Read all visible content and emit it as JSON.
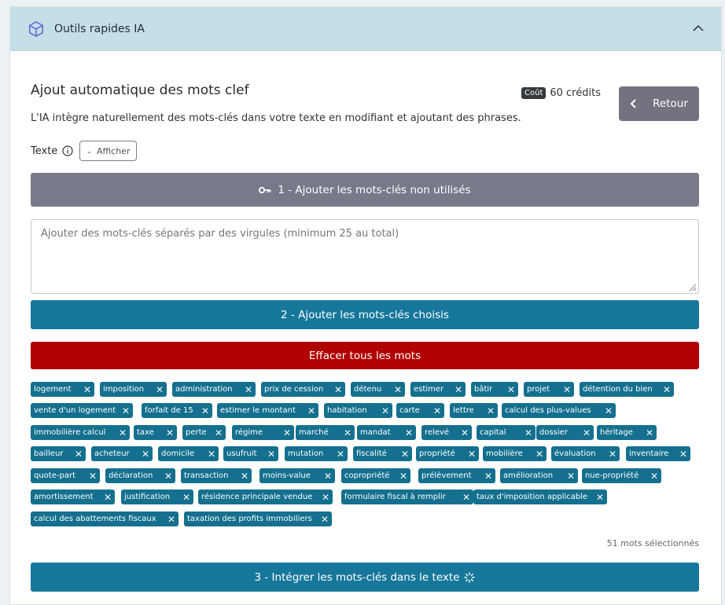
{
  "header": {
    "title": "Outils rapides IA"
  },
  "tool": {
    "title": "Ajout automatique des mots clef",
    "description": "L'IA intègre naturellement des mots-clés dans votre texte en modifiant et ajoutant des phrases.",
    "cost_badge": "Coût",
    "cost_value": "60 crédits",
    "back_label": "Retour",
    "texte_label": "Texte",
    "afficher_label": "Afficher"
  },
  "step1": {
    "label": "1 - Ajouter les mots-clés non utilisés"
  },
  "keywords_input": {
    "placeholder": "Ajouter des mots-clés séparés par des virgules (minimum 25 au total)",
    "value": ""
  },
  "step2": {
    "label": "2 - Ajouter les mots-clés choisis"
  },
  "clear": {
    "label": "Effacer tous les mots"
  },
  "tags": [
    "logement",
    "imposition",
    "administration",
    "prix de cession",
    "détenu",
    "estimer",
    "bâtir",
    "projet",
    "détention du bien",
    "vente d'un logement",
    "forfait de 15",
    "estimer le montant",
    "habitation",
    "carte",
    "lettre",
    "calcul des plus-values",
    "immobilière calcul",
    "taxe",
    "perte",
    "régime",
    "marché",
    "mandat",
    "relevé",
    "capital",
    "dossier",
    "héritage",
    "bailleur",
    "acheteur",
    "domicile",
    "usufruit",
    "mutation",
    "fiscalité",
    "propriété",
    "mobilière",
    "évaluation",
    "inventaire",
    "quote-part",
    "déclaration",
    "transaction",
    "moins-value",
    "copropriété",
    "prélèvement",
    "amélioration",
    "nue-propriété",
    "amortissement",
    "justification",
    "résidence principale vendue",
    "formulaire fiscal à remplir",
    "taux d'imposition applicable",
    "calcul des abattements fiscaux",
    "taxation des profits immobiliers"
  ],
  "selected_count": "51 mots sélectionnés",
  "step3": {
    "label": "3 - Intégrer les mots-clés dans le texte"
  },
  "colors": {
    "primary": "#17779a",
    "tag": "#14708e",
    "danger": "#b00000",
    "gray_button": "#777b89",
    "header_bg": "#c5dfe7"
  },
  "icons": [
    "cube-icon",
    "chevron-up-icon",
    "chevron-left-icon",
    "info-icon",
    "chevron-down-icon",
    "key-icon",
    "close-icon",
    "spinner-icon",
    "resize-handle-icon"
  ]
}
